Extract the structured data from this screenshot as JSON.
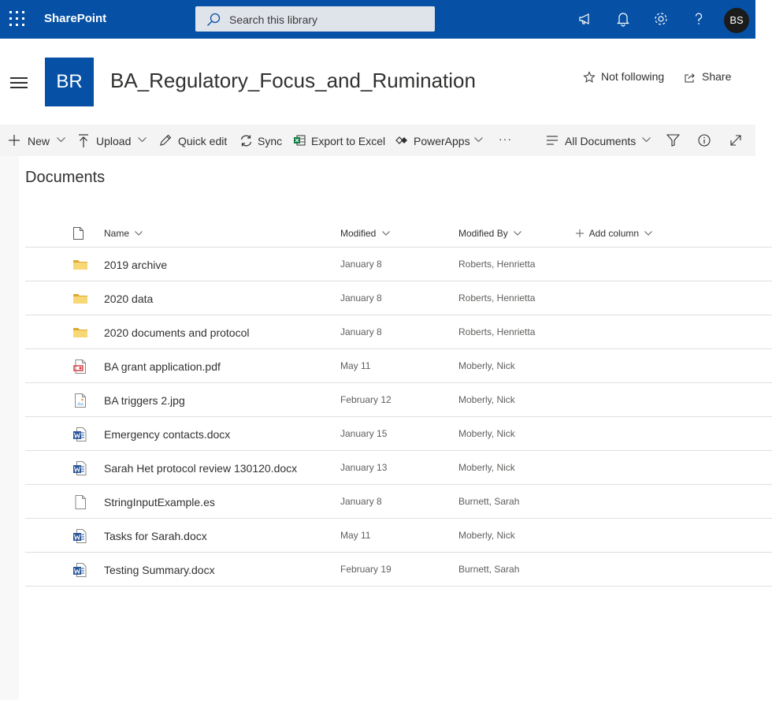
{
  "suite_bar": {
    "brand": "SharePoint",
    "search_placeholder": "Search this library",
    "avatar_initials": "BS",
    "color": "#0650a5"
  },
  "site": {
    "logo_initials": "BR",
    "title": "BA_Regulatory_Focus_and_Rumination",
    "follow_label": "Not following",
    "share_label": "Share"
  },
  "command_bar": {
    "new_label": "New",
    "upload_label": "Upload",
    "quick_edit_label": "Quick edit",
    "sync_label": "Sync",
    "export_label": "Export to Excel",
    "powerapps_label": "PowerApps",
    "more_label": "···",
    "view_label": "All Documents"
  },
  "library": {
    "title": "Documents",
    "columns": {
      "name": "Name",
      "modified": "Modified",
      "modified_by": "Modified By",
      "add_column": "Add column"
    },
    "rows": [
      {
        "icon": "folder-icon",
        "name": "2019 archive",
        "modified": "January 8",
        "modified_by": "Roberts, Henrietta"
      },
      {
        "icon": "folder-icon",
        "name": "2020 data",
        "modified": "January 8",
        "modified_by": "Roberts, Henrietta"
      },
      {
        "icon": "folder-icon",
        "name": "2020 documents and protocol",
        "modified": "January 8",
        "modified_by": "Roberts, Henrietta"
      },
      {
        "icon": "pdf-file-icon",
        "name": "BA grant application.pdf",
        "modified": "May 11",
        "modified_by": "Moberly, Nick"
      },
      {
        "icon": "image-file-icon",
        "name": "BA triggers 2.jpg",
        "modified": "February 12",
        "modified_by": "Moberly, Nick"
      },
      {
        "icon": "word-file-icon",
        "name": "Emergency contacts.docx",
        "modified": "January 15",
        "modified_by": "Moberly, Nick"
      },
      {
        "icon": "word-file-icon",
        "name": "Sarah Het protocol review 130120.docx",
        "modified": "January 13",
        "modified_by": "Moberly, Nick"
      },
      {
        "icon": "generic-file-icon",
        "name": "StringInputExample.es",
        "modified": "January 8",
        "modified_by": "Burnett, Sarah"
      },
      {
        "icon": "word-file-icon",
        "name": "Tasks for Sarah.docx",
        "modified": "May 11",
        "modified_by": "Moberly, Nick"
      },
      {
        "icon": "word-file-icon",
        "name": "Testing Summary.docx",
        "modified": "February 19",
        "modified_by": "Burnett, Sarah"
      }
    ]
  }
}
